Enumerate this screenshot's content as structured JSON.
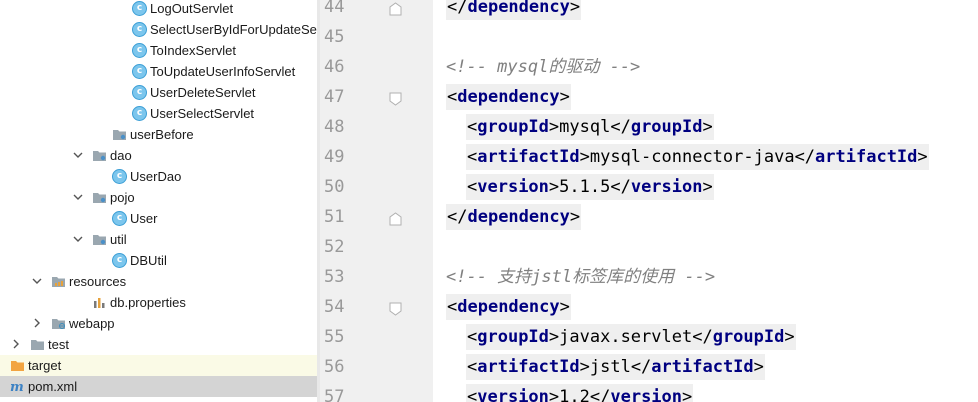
{
  "project_tree": {
    "items": [
      {
        "label": "LogOutServlet",
        "kind": "class",
        "depth": 6,
        "expand": "none"
      },
      {
        "label": "SelectUserByIdForUpdateServlet",
        "kind": "class",
        "depth": 6,
        "expand": "none"
      },
      {
        "label": "ToIndexServlet",
        "kind": "class",
        "depth": 6,
        "expand": "none"
      },
      {
        "label": "ToUpdateUserInfoServlet",
        "kind": "class",
        "depth": 6,
        "expand": "none"
      },
      {
        "label": "UserDeleteServlet",
        "kind": "class",
        "depth": 6,
        "expand": "none"
      },
      {
        "label": "UserSelectServlet",
        "kind": "class",
        "depth": 6,
        "expand": "none"
      },
      {
        "label": "userBefore",
        "kind": "package",
        "depth": 5,
        "expand": "none"
      },
      {
        "label": "dao",
        "kind": "package",
        "depth": 4,
        "expand": "open"
      },
      {
        "label": "UserDao",
        "kind": "class",
        "depth": 5,
        "expand": "none"
      },
      {
        "label": "pojo",
        "kind": "package",
        "depth": 4,
        "expand": "open"
      },
      {
        "label": "User",
        "kind": "class",
        "depth": 5,
        "expand": "none"
      },
      {
        "label": "util",
        "kind": "package",
        "depth": 4,
        "expand": "open"
      },
      {
        "label": "DBUtil",
        "kind": "class",
        "depth": 5,
        "expand": "none"
      },
      {
        "label": "resources",
        "kind": "resources-folder",
        "depth": 2,
        "expand": "open"
      },
      {
        "label": "db.properties",
        "kind": "properties-file",
        "depth": 4,
        "expand": "none"
      },
      {
        "label": "webapp",
        "kind": "web-folder",
        "depth": 2,
        "expand": "closed"
      },
      {
        "label": "test",
        "kind": "folder",
        "depth": 1,
        "expand": "closed"
      },
      {
        "label": "target",
        "kind": "excluded-folder",
        "depth": 0,
        "expand": "closed"
      },
      {
        "label": "pom.xml",
        "kind": "maven-file",
        "depth": 0,
        "expand": "none"
      }
    ]
  },
  "editor": {
    "lines": [
      {
        "num": "44",
        "fold": "end",
        "parts": [
          {
            "t": "bracket",
            "v": "</"
          },
          {
            "t": "tag-name",
            "v": "dependency"
          },
          {
            "t": "bracket",
            "v": ">"
          }
        ],
        "indent": 0,
        "boxed": true
      },
      {
        "num": "45",
        "fold": "",
        "parts": [],
        "indent": 0,
        "boxed": false
      },
      {
        "num": "46",
        "fold": "",
        "parts": [
          {
            "t": "comment",
            "v": "<!-- mysql的驱动 -->"
          }
        ],
        "indent": 0,
        "boxed": false
      },
      {
        "num": "47",
        "fold": "start",
        "parts": [
          {
            "t": "bracket",
            "v": "<"
          },
          {
            "t": "tag-name",
            "v": "dependency"
          },
          {
            "t": "bracket",
            "v": ">"
          }
        ],
        "indent": 0,
        "boxed": true
      },
      {
        "num": "48",
        "fold": "",
        "parts": [
          {
            "t": "bracket",
            "v": "<"
          },
          {
            "t": "tag-name",
            "v": "groupId"
          },
          {
            "t": "bracket",
            "v": ">"
          },
          {
            "t": "value",
            "v": "mysql"
          },
          {
            "t": "bracket",
            "v": "</"
          },
          {
            "t": "tag-name",
            "v": "groupId"
          },
          {
            "t": "bracket",
            "v": ">"
          }
        ],
        "indent": 1,
        "boxed": true
      },
      {
        "num": "49",
        "fold": "",
        "parts": [
          {
            "t": "bracket",
            "v": "<"
          },
          {
            "t": "tag-name",
            "v": "artifactId"
          },
          {
            "t": "bracket",
            "v": ">"
          },
          {
            "t": "value",
            "v": "mysql-connector-java"
          },
          {
            "t": "bracket",
            "v": "</"
          },
          {
            "t": "tag-name",
            "v": "artifactId"
          },
          {
            "t": "bracket",
            "v": ">"
          }
        ],
        "indent": 1,
        "boxed": true
      },
      {
        "num": "50",
        "fold": "",
        "parts": [
          {
            "t": "bracket",
            "v": "<"
          },
          {
            "t": "tag-name",
            "v": "version"
          },
          {
            "t": "bracket",
            "v": ">"
          },
          {
            "t": "value",
            "v": "5.1.5"
          },
          {
            "t": "bracket",
            "v": "</"
          },
          {
            "t": "tag-name",
            "v": "version"
          },
          {
            "t": "bracket",
            "v": ">"
          }
        ],
        "indent": 1,
        "boxed": true
      },
      {
        "num": "51",
        "fold": "end",
        "parts": [
          {
            "t": "bracket",
            "v": "</"
          },
          {
            "t": "tag-name",
            "v": "dependency"
          },
          {
            "t": "bracket",
            "v": ">"
          }
        ],
        "indent": 0,
        "boxed": true
      },
      {
        "num": "52",
        "fold": "",
        "parts": [],
        "indent": 0,
        "boxed": false
      },
      {
        "num": "53",
        "fold": "",
        "parts": [
          {
            "t": "comment",
            "v": "<!-- 支持jstl标签库的使用 -->"
          }
        ],
        "indent": 0,
        "boxed": false
      },
      {
        "num": "54",
        "fold": "start",
        "parts": [
          {
            "t": "bracket",
            "v": "<"
          },
          {
            "t": "tag-name",
            "v": "dependency"
          },
          {
            "t": "bracket",
            "v": ">"
          }
        ],
        "indent": 0,
        "boxed": true
      },
      {
        "num": "55",
        "fold": "",
        "parts": [
          {
            "t": "bracket",
            "v": "<"
          },
          {
            "t": "tag-name",
            "v": "groupId"
          },
          {
            "t": "bracket",
            "v": ">"
          },
          {
            "t": "value",
            "v": "javax.servlet"
          },
          {
            "t": "bracket",
            "v": "</"
          },
          {
            "t": "tag-name",
            "v": "groupId"
          },
          {
            "t": "bracket",
            "v": ">"
          }
        ],
        "indent": 1,
        "boxed": true
      },
      {
        "num": "56",
        "fold": "",
        "parts": [
          {
            "t": "bracket",
            "v": "<"
          },
          {
            "t": "tag-name",
            "v": "artifactId"
          },
          {
            "t": "bracket",
            "v": ">"
          },
          {
            "t": "value",
            "v": "jstl"
          },
          {
            "t": "bracket",
            "v": "</"
          },
          {
            "t": "tag-name",
            "v": "artifactId"
          },
          {
            "t": "bracket",
            "v": ">"
          }
        ],
        "indent": 1,
        "boxed": true
      },
      {
        "num": "57",
        "fold": "",
        "parts": [
          {
            "t": "bracket",
            "v": "<"
          },
          {
            "t": "tag-name",
            "v": "version"
          },
          {
            "t": "bracket",
            "v": ">"
          },
          {
            "t": "value",
            "v": "1.2"
          },
          {
            "t": "bracket",
            "v": "</"
          },
          {
            "t": "tag-name",
            "v": "version"
          },
          {
            "t": "bracket",
            "v": ">"
          }
        ],
        "indent": 1,
        "boxed": true
      }
    ]
  },
  "colors": {
    "tag_name": "#000080",
    "comment": "#808080",
    "class_icon": "#7cc6ed",
    "folder": "#9aa7b0",
    "excluded_folder": "#f2a441",
    "selected_row": "#d4d4d4",
    "gutter": "#f0f0f0"
  },
  "icons": {
    "class": "class-c-icon",
    "package": "package-folder-icon",
    "folder": "folder-icon",
    "resources-folder": "resources-folder-icon",
    "web-folder": "web-folder-icon",
    "excluded-folder": "excluded-folder-icon",
    "properties-file": "properties-file-icon",
    "maven-file": "maven-file-icon",
    "chevron_open": "chevron-down-icon",
    "chevron_closed": "chevron-right-icon"
  }
}
